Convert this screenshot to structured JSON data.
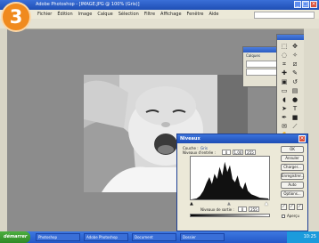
{
  "badge": {
    "step": "3"
  },
  "window": {
    "title": "Adobe Photoshop - [IMAGE.JPG @ 100% (Gris)]"
  },
  "menu": [
    "Fichier",
    "Édition",
    "Image",
    "Calque",
    "Sélection",
    "Filtre",
    "Affichage",
    "Fenêtre",
    "Aide"
  ],
  "layers_panel": {
    "tab": "Calques"
  },
  "levels_dialog": {
    "title": "Niveaux",
    "channel_label": "Couche :",
    "channel_value": "Gris",
    "input_levels_label": "Niveaux d'entrée :",
    "input_black": "0",
    "input_gamma": "1,00",
    "input_white": "255",
    "output_levels_label": "Niveaux de sortie :",
    "output_black": "0",
    "output_white": "255",
    "buttons": [
      "OK",
      "Annuler",
      "Charger...",
      "Enregistrer...",
      "Auto",
      "Options..."
    ],
    "preview_label": "Aperçu"
  },
  "taskbar": {
    "start_label": "démarrer",
    "tasks": [
      "Photoshop",
      "Adobe Photoshop",
      "Document",
      "Dossier"
    ],
    "clock": "10:25"
  }
}
